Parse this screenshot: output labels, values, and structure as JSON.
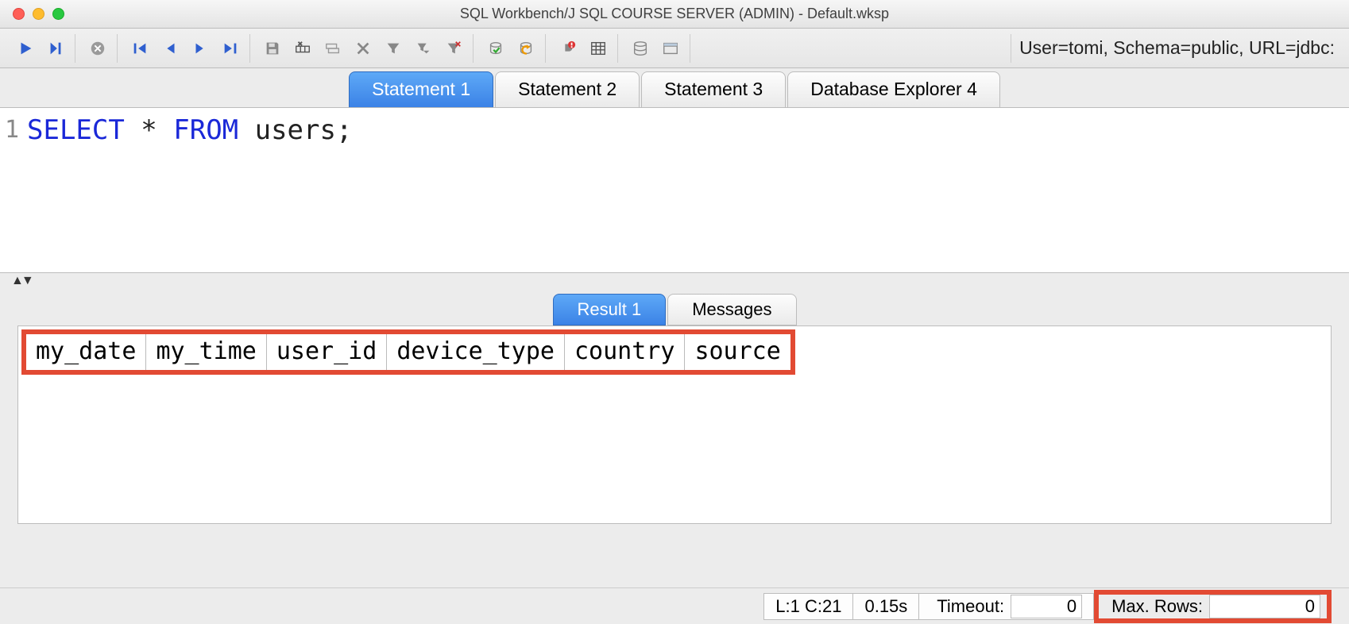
{
  "window": {
    "title": "SQL Workbench/J SQL COURSE SERVER (ADMIN) - Default.wksp"
  },
  "connection_info": "User=tomi, Schema=public, URL=jdbc:",
  "tabs": [
    {
      "label": "Statement 1",
      "active": true
    },
    {
      "label": "Statement 2",
      "active": false
    },
    {
      "label": "Statement 3",
      "active": false
    },
    {
      "label": "Database Explorer 4",
      "active": false
    }
  ],
  "sql": {
    "line_number": "1",
    "tokens": [
      {
        "text": "SELECT",
        "cls": "kw"
      },
      {
        "text": " * ",
        "cls": "txt"
      },
      {
        "text": "FROM",
        "cls": "kw"
      },
      {
        "text": " users;",
        "cls": "txt"
      }
    ]
  },
  "result_tabs": [
    {
      "label": "Result 1",
      "active": true
    },
    {
      "label": "Messages",
      "active": false
    }
  ],
  "columns": [
    "my_date",
    "my_time",
    "user_id",
    "device_type",
    "country",
    "source"
  ],
  "status": {
    "cursor": "L:1 C:21",
    "elapsed": "0.15s",
    "timeout_label": "Timeout:",
    "timeout_value": "0",
    "maxrows_label": "Max. Rows:",
    "maxrows_value": "0"
  },
  "icons": {
    "run": "run-icon",
    "run_to_cursor": "run-to-cursor-icon",
    "stop": "stop-icon",
    "first": "first-record-icon",
    "prev": "prev-record-icon",
    "next": "next-record-icon",
    "last": "last-record-icon",
    "save": "save-icon",
    "insert_row": "insert-row-icon",
    "copy_row": "copy-row-icon",
    "delete_row": "delete-row-icon",
    "filter": "filter-icon",
    "filter_drop": "filter-dropdown-icon",
    "filter_clear": "filter-clear-icon",
    "commit": "commit-icon",
    "rollback": "rollback-icon",
    "reconnect": "reconnect-icon",
    "explorer": "grid-icon",
    "db": "database-icon",
    "db_explorer": "db-explorer-icon"
  }
}
